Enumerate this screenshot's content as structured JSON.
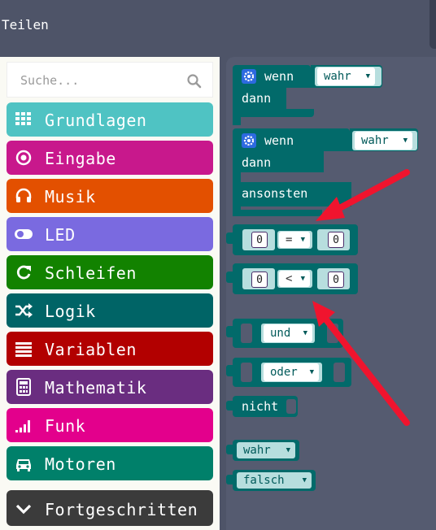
{
  "header": {
    "share_label": "Teilen"
  },
  "toolbox": {
    "search_placeholder": "Suche...",
    "categories": [
      {
        "label": "Grundlagen",
        "color": "#4fc3c3",
        "icon": "grid-icon"
      },
      {
        "label": "Eingabe",
        "color": "#c8188c",
        "icon": "target-icon"
      },
      {
        "label": "Musik",
        "color": "#e35000",
        "icon": "headphones-icon"
      },
      {
        "label": "LED",
        "color": "#7a6ae0",
        "icon": "toggle-icon"
      },
      {
        "label": "Schleifen",
        "color": "#128200",
        "icon": "refresh-icon"
      },
      {
        "label": "Logik",
        "color": "#006466",
        "icon": "shuffle-icon"
      },
      {
        "label": "Variablen",
        "color": "#b20000",
        "icon": "list-icon"
      },
      {
        "label": "Mathematik",
        "color": "#6a2d80",
        "icon": "calculator-icon"
      },
      {
        "label": "Funk",
        "color": "#e3008c",
        "icon": "signal-icon"
      },
      {
        "label": "Motoren",
        "color": "#00806a",
        "icon": "car-icon"
      },
      {
        "label": "Fortgeschritten",
        "color": "#3b3b3b",
        "icon": "chevron-down-icon"
      }
    ]
  },
  "flyout": {
    "if_block": {
      "if_label": "wenn",
      "then_label": "dann",
      "value": "wahr"
    },
    "if_else_block": {
      "if_label": "wenn",
      "then_label": "dann",
      "else_label": "ansonsten",
      "value": "wahr"
    },
    "compare_eq": {
      "left": "0",
      "operator": "=",
      "right": "0"
    },
    "compare_lt": {
      "left": "0",
      "operator": "<",
      "right": "0"
    },
    "and_block": {
      "label": "und"
    },
    "or_block": {
      "label": "oder"
    },
    "not_block": {
      "label": "nicht"
    },
    "true_block": {
      "label": "wahr"
    },
    "false_block": {
      "label": "falsch"
    }
  },
  "colors": {
    "logic_block": "#026a6a",
    "arrow": "#f0142e",
    "flyout_bg": "#555b70",
    "workspace_bg": "#4e5468"
  }
}
